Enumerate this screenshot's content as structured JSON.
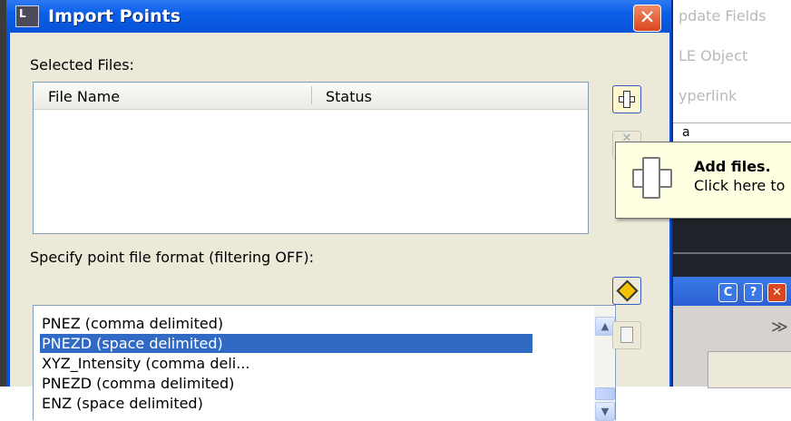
{
  "dialog": {
    "title": "Import Points",
    "close_glyph": "✕",
    "icon_glyph": "L"
  },
  "selected_files": {
    "label": "Selected Files:",
    "columns": [
      "File Name",
      "Status"
    ],
    "rows": []
  },
  "format": {
    "label": "Specify point file format (filtering OFF):",
    "items": [
      "PNEZ (comma delimited)",
      "PNEZD (space delimited)",
      "XYZ_Intensity (comma deli...",
      "PNEZD (comma delimited)",
      "ENZ (space delimited)"
    ],
    "selected_index": 1
  },
  "tooltip": {
    "title": "Add files.",
    "description": "Click here to"
  },
  "background_app": {
    "menu_items": [
      "pdate Fields",
      "LE Object",
      "yperlink"
    ],
    "row_text": "a",
    "chevron": "≫",
    "mini_buttons": [
      "C",
      "?",
      "✕"
    ]
  },
  "scroll": {
    "up": "▲",
    "down": "▼"
  },
  "colors": {
    "titlebar": "#0a5fe8",
    "selection": "#316ac5",
    "tooltip_bg": "#ffffe1",
    "close": "#d9461f"
  }
}
